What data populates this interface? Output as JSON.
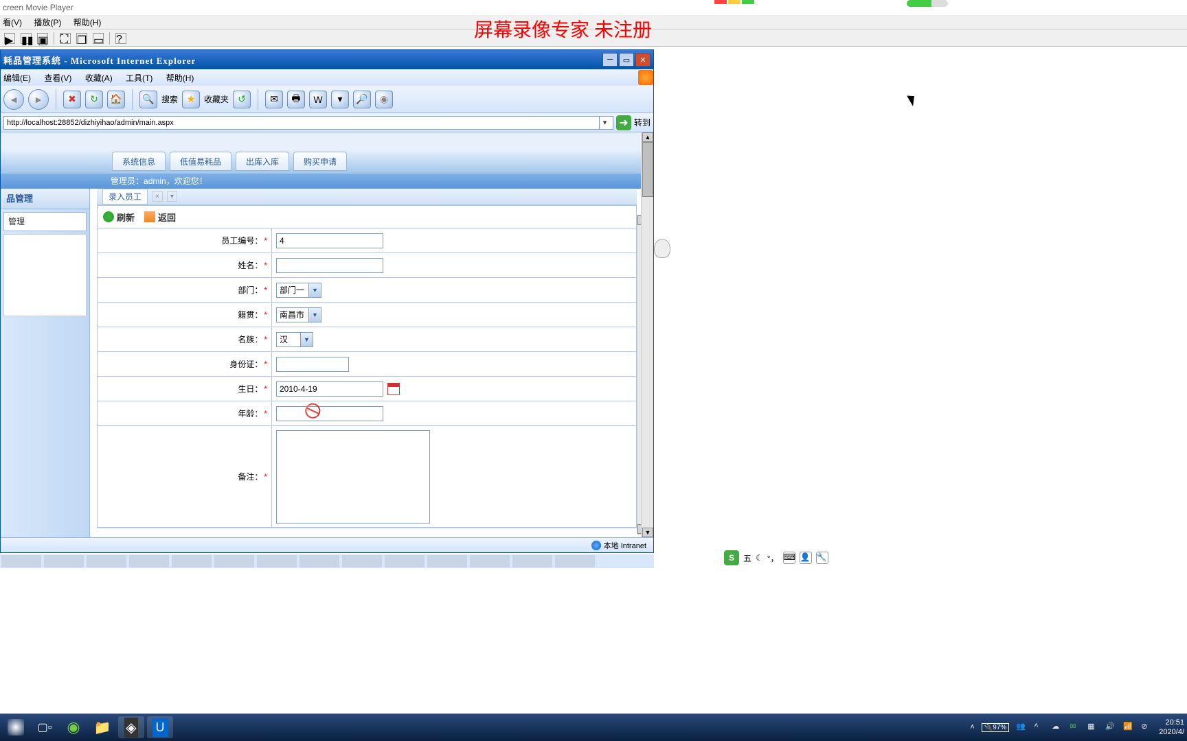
{
  "player": {
    "title": "creen Movie Player",
    "menu": {
      "view": "看(V)",
      "play": "播放(P)",
      "help": "帮助(H)"
    }
  },
  "watermark": "屏幕录像专家  未注册",
  "ie": {
    "title": "耗品管理系统 - Microsoft Internet Explorer",
    "menu": {
      "edit": "编辑(E)",
      "view": "查看(V)",
      "fav": "收藏(A)",
      "tools": "工具(T)",
      "help": "帮助(H)"
    },
    "toolbar": {
      "search": "搜索",
      "favorites": "收藏夹"
    },
    "address": "http://localhost:28852/dizhiyihao/admin/main.aspx",
    "go": "转到",
    "status": "本地 Intranet"
  },
  "app": {
    "tabs": {
      "t1": "系统信息",
      "t2": "低值易耗品",
      "t3": "出库入库",
      "t4": "购买申请"
    },
    "welcome_prefix": "管理员：",
    "welcome_user": "admin",
    "welcome_suffix": "，欢迎您！",
    "left": {
      "section": "品管理",
      "item": "管理"
    },
    "tab2": {
      "label": "录入员工"
    },
    "actions": {
      "refresh": "刷新",
      "back": "返回"
    },
    "form": {
      "emp_no_lbl": "员工编号：",
      "emp_no_val": "4",
      "name_lbl": "姓名：",
      "name_val": "",
      "dept_lbl": "部门：",
      "dept_val": "部门一",
      "origin_lbl": "籍贯：",
      "origin_val": "南昌市",
      "nation_lbl": "名族：",
      "nation_val": "汉",
      "idcard_lbl": "身份证：",
      "idcard_val": "",
      "bday_lbl": "生日：",
      "bday_val": "2010-4-19",
      "age_lbl": "年龄：",
      "age_val": "",
      "remark_lbl": "备注：",
      "remark_val": ""
    }
  },
  "ime": {
    "label": "五"
  },
  "taskbar": {
    "battery": "97%",
    "time": "20:51",
    "date": "2020/4/"
  }
}
